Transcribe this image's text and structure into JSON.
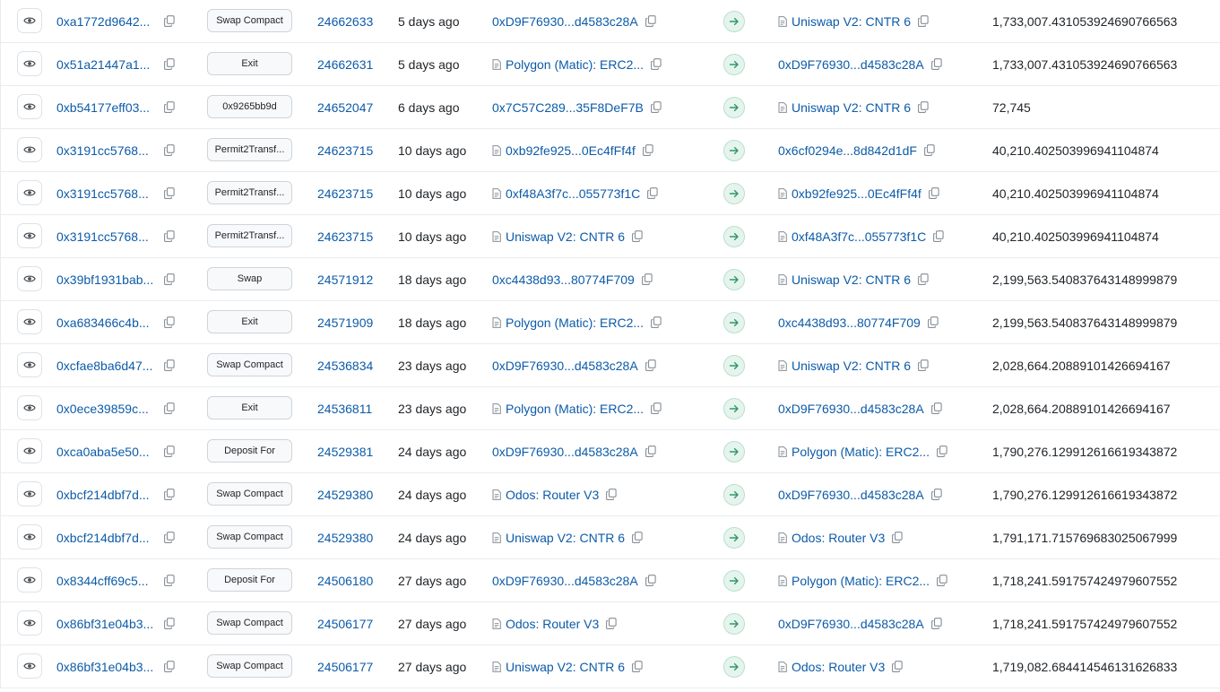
{
  "colors": {
    "link": "#0c5ba8",
    "arrow_bg": "#e6f4ee",
    "arrow_fg": "#2f9a6a"
  },
  "rows": [
    {
      "hash": "0xa1772d9642...",
      "method": "Swap Compact",
      "block": "24662633",
      "age": "5 days ago",
      "from": "0xD9F76930...d4583c28A",
      "from_contract": false,
      "to": "Uniswap V2: CNTR 6",
      "to_contract": true,
      "amount": "1,733,007.431053924690766563"
    },
    {
      "hash": "0x51a21447a1...",
      "method": "Exit",
      "block": "24662631",
      "age": "5 days ago",
      "from": "Polygon (Matic): ERC2...",
      "from_contract": true,
      "to": "0xD9F76930...d4583c28A",
      "to_contract": false,
      "amount": "1,733,007.431053924690766563"
    },
    {
      "hash": "0xb54177eff03...",
      "method": "0x9265bb9d",
      "block": "24652047",
      "age": "6 days ago",
      "from": "0x7C57C289...35F8DeF7B",
      "from_contract": false,
      "to": "Uniswap V2: CNTR 6",
      "to_contract": true,
      "amount": "72,745"
    },
    {
      "hash": "0x3191cc5768...",
      "method": "Permit2Transf...",
      "block": "24623715",
      "age": "10 days ago",
      "from": "0xb92fe925...0Ec4fFf4f",
      "from_contract": true,
      "to": "0x6cf0294e...8d842d1dF",
      "to_contract": false,
      "amount": "40,210.402503996941104874"
    },
    {
      "hash": "0x3191cc5768...",
      "method": "Permit2Transf...",
      "block": "24623715",
      "age": "10 days ago",
      "from": "0xf48A3f7c...055773f1C",
      "from_contract": true,
      "to": "0xb92fe925...0Ec4fFf4f",
      "to_contract": true,
      "amount": "40,210.402503996941104874"
    },
    {
      "hash": "0x3191cc5768...",
      "method": "Permit2Transf...",
      "block": "24623715",
      "age": "10 days ago",
      "from": "Uniswap V2: CNTR 6",
      "from_contract": true,
      "to": "0xf48A3f7c...055773f1C",
      "to_contract": true,
      "amount": "40,210.402503996941104874"
    },
    {
      "hash": "0x39bf1931bab...",
      "method": "Swap",
      "block": "24571912",
      "age": "18 days ago",
      "from": "0xc4438d93...80774F709",
      "from_contract": false,
      "to": "Uniswap V2: CNTR 6",
      "to_contract": true,
      "amount": "2,199,563.540837643148999879"
    },
    {
      "hash": "0xa683466c4b...",
      "method": "Exit",
      "block": "24571909",
      "age": "18 days ago",
      "from": "Polygon (Matic): ERC2...",
      "from_contract": true,
      "to": "0xc4438d93...80774F709",
      "to_contract": false,
      "amount": "2,199,563.540837643148999879"
    },
    {
      "hash": "0xcfae8ba6d47...",
      "method": "Swap Compact",
      "block": "24536834",
      "age": "23 days ago",
      "from": "0xD9F76930...d4583c28A",
      "from_contract": false,
      "to": "Uniswap V2: CNTR 6",
      "to_contract": true,
      "amount": "2,028,664.20889101426694167"
    },
    {
      "hash": "0x0ece39859c...",
      "method": "Exit",
      "block": "24536811",
      "age": "23 days ago",
      "from": "Polygon (Matic): ERC2...",
      "from_contract": true,
      "to": "0xD9F76930...d4583c28A",
      "to_contract": false,
      "amount": "2,028,664.20889101426694167"
    },
    {
      "hash": "0xca0aba5e50...",
      "method": "Deposit For",
      "block": "24529381",
      "age": "24 days ago",
      "from": "0xD9F76930...d4583c28A",
      "from_contract": false,
      "to": "Polygon (Matic): ERC2...",
      "to_contract": true,
      "amount": "1,790,276.129912616619343872"
    },
    {
      "hash": "0xbcf214dbf7d...",
      "method": "Swap Compact",
      "block": "24529380",
      "age": "24 days ago",
      "from": "Odos: Router V3",
      "from_contract": true,
      "to": "0xD9F76930...d4583c28A",
      "to_contract": false,
      "amount": "1,790,276.129912616619343872"
    },
    {
      "hash": "0xbcf214dbf7d...",
      "method": "Swap Compact",
      "block": "24529380",
      "age": "24 days ago",
      "from": "Uniswap V2: CNTR 6",
      "from_contract": true,
      "to": "Odos: Router V3",
      "to_contract": true,
      "amount": "1,791,171.715769683025067999"
    },
    {
      "hash": "0x8344cff69c5...",
      "method": "Deposit For",
      "block": "24506180",
      "age": "27 days ago",
      "from": "0xD9F76930...d4583c28A",
      "from_contract": false,
      "to": "Polygon (Matic): ERC2...",
      "to_contract": true,
      "amount": "1,718,241.591757424979607552"
    },
    {
      "hash": "0x86bf31e04b3...",
      "method": "Swap Compact",
      "block": "24506177",
      "age": "27 days ago",
      "from": "Odos: Router V3",
      "from_contract": true,
      "to": "0xD9F76930...d4583c28A",
      "to_contract": false,
      "amount": "1,718,241.591757424979607552"
    },
    {
      "hash": "0x86bf31e04b3...",
      "method": "Swap Compact",
      "block": "24506177",
      "age": "27 days ago",
      "from": "Uniswap V2: CNTR 6",
      "from_contract": true,
      "to": "Odos: Router V3",
      "to_contract": true,
      "amount": "1,719,082.684414546131626833"
    }
  ]
}
